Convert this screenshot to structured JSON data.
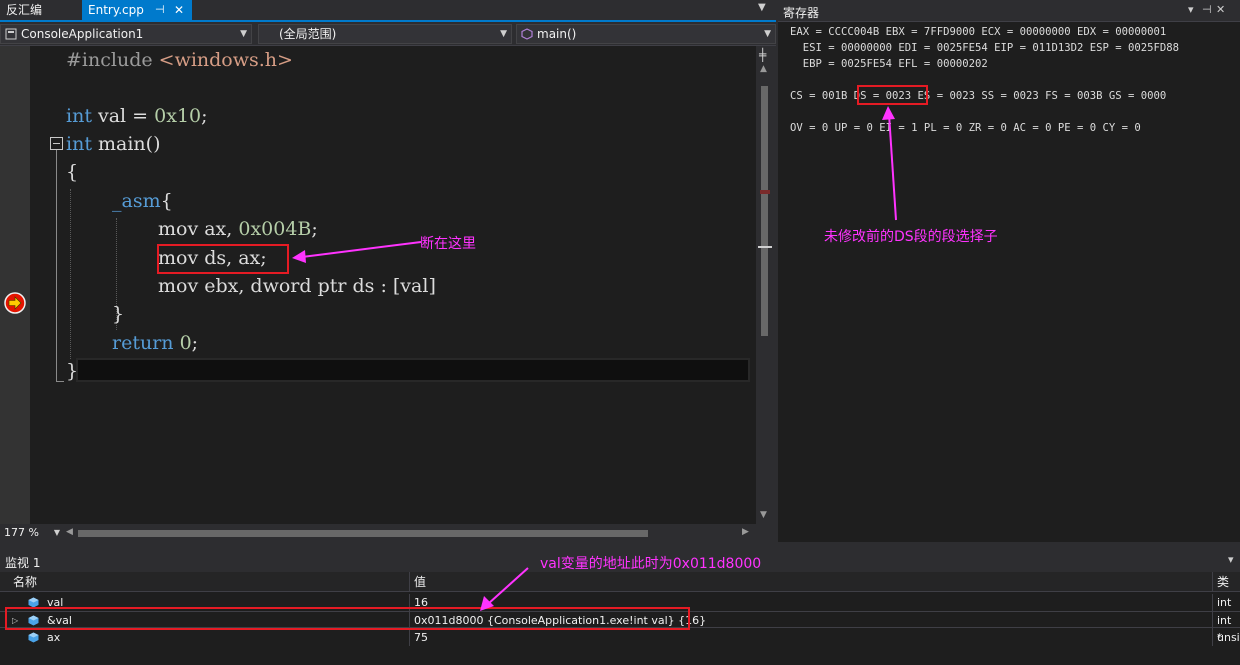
{
  "tabs": {
    "disasm": "反汇编",
    "entry": "Entry.cpp",
    "pin_glyph": "⊣",
    "close_glyph": "✕"
  },
  "navbar": {
    "project": "ConsoleApplication1",
    "scope": "(全局范围)",
    "function": "main()"
  },
  "code": {
    "lines": [
      {
        "pp": "#include",
        "rest": " <windows.h>"
      },
      {
        "kw": "int",
        "rest": " val = ",
        "num": "0x10",
        "tail": ";"
      },
      {
        "kw": "int",
        "rest": " main()"
      },
      {
        "rest": "{"
      },
      {
        "kw": "_asm",
        "rest": "{"
      },
      {
        "rest": "mov ax, ",
        "num": "0x004B",
        "tail": ";"
      },
      {
        "rest": "mov ds, ax;"
      },
      {
        "rest": "mov ebx, dword ptr ds : [val]"
      },
      {
        "rest": "}"
      },
      {
        "kw": "return",
        "rest": " ",
        "num": "0",
        "tail": ";"
      },
      {
        "rest": "}"
      }
    ],
    "annotation": "断在这里",
    "zoom": "177 %"
  },
  "registers": {
    "title": "寄存器",
    "lines": [
      "EAX = CCCC004B EBX = 7FFD9000 ECX = 00000000 EDX = 00000001",
      "  ESI = 00000000 EDI = 0025FE54 EIP = 011D13D2 ESP = 0025FD88",
      "  EBP = 0025FE54 EFL = 00000202",
      "CS = 001B DS = 0023 ES = 0023 SS = 0023 FS = 003B GS = 0000",
      "OV = 0 UP = 0 EI = 1 PL = 0 ZR = 0 AC = 0 PE = 0 CY = 0"
    ],
    "annotation": "未修改前的DS段的段选择子"
  },
  "watch": {
    "title": "监视 1",
    "annotation": "val变量的地址此时为0x011d8000",
    "columns": {
      "name": "名称",
      "value": "值",
      "type": "类型"
    },
    "rows": [
      {
        "name": "val",
        "value": "16",
        "type": "int"
      },
      {
        "name": "&val",
        "value": "0x011d8000 {ConsoleApplication1.exe!int val} {16}",
        "type": "int *"
      },
      {
        "name": "ax",
        "value": "75",
        "type": "unsi"
      }
    ]
  },
  "colors": {
    "accent": "#007acc",
    "annotation": "#ff33ff",
    "highlight_box": "#e51b24",
    "keyword": "#569cd6",
    "number": "#b5cea8"
  }
}
